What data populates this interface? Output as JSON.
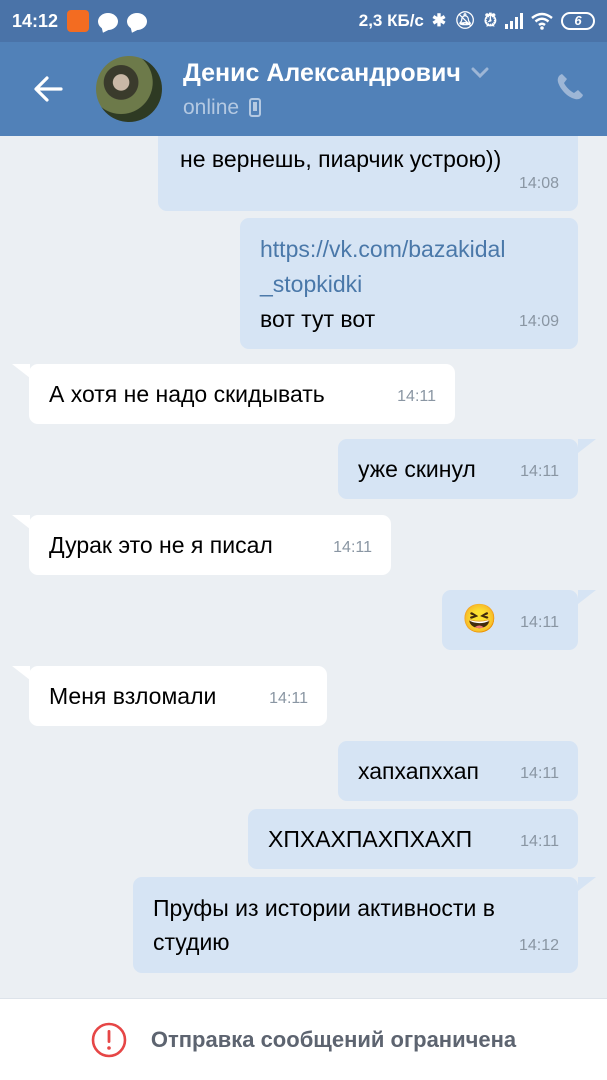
{
  "status_bar": {
    "time": "14:12",
    "speed": "2,3 КБ/с",
    "battery": "6",
    "icons": [
      "app-notification-icon",
      "chat-bubble-icon",
      "chat-bubble-icon",
      "bluetooth-icon",
      "mute-icon",
      "alarm-icon",
      "signal-icon",
      "wifi-icon",
      "battery-icon"
    ]
  },
  "header": {
    "title": "Денис Александрович",
    "subtitle": "online",
    "back_icon": "arrow-left-icon",
    "dropdown_icon": "chevron-down-icon",
    "device_icon": "mobile-icon",
    "call_icon": "phone-icon"
  },
  "messages": [
    {
      "dir": "out",
      "text": "не вернешь, пиарчик устрою))",
      "time": "14:08"
    },
    {
      "dir": "out",
      "link": "https://vk.com/bazakidal_stopkidki",
      "link_line1": "https://vk.com/bazakidal",
      "link_line2": "_stopkidki",
      "text": "вот тут вот",
      "time": "14:09"
    },
    {
      "dir": "in",
      "text": "А хотя не надо скидывать",
      "time": "14:11"
    },
    {
      "dir": "out",
      "text": "уже скинул",
      "time": "14:11"
    },
    {
      "dir": "in",
      "text": "Дурак это не я писал",
      "time": "14:11"
    },
    {
      "dir": "out",
      "emoji": "😆",
      "time": "14:11"
    },
    {
      "dir": "in",
      "text": "Меня взломали",
      "time": "14:11"
    },
    {
      "dir": "out",
      "text": "хапхапххап",
      "time": "14:11"
    },
    {
      "dir": "out",
      "text": "ХПХАХПАХПХАХП",
      "time": "14:11"
    },
    {
      "dir": "out",
      "text_line1": "Пруфы из истории активности в",
      "text_line2": "студию",
      "time": "14:12"
    }
  ],
  "footer": {
    "notice": "Отправка сообщений ограничена",
    "icon": "alert-circle-icon",
    "icon_color": "#e64646"
  },
  "colors": {
    "status_bar": "#4a73a8",
    "header": "#5181b8",
    "background": "#ebeff3",
    "outgoing_bubble": "#d6e4f4",
    "incoming_bubble": "#ffffff",
    "link": "#4a78a9"
  }
}
